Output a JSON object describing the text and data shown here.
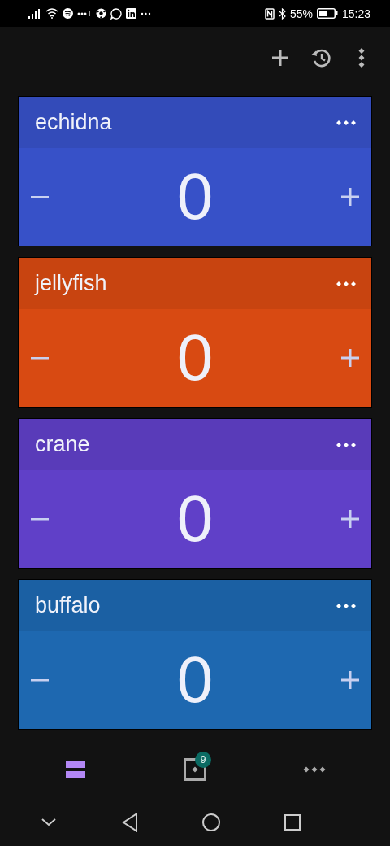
{
  "status_bar": {
    "battery": "55%",
    "time": "15:23"
  },
  "counters": [
    {
      "name": "echidna",
      "value": "0",
      "color": "#3751c8"
    },
    {
      "name": "jellyfish",
      "value": "0",
      "color": "#d84a12"
    },
    {
      "name": "crane",
      "value": "0",
      "color": "#6040c8"
    },
    {
      "name": "buffalo",
      "value": "0",
      "color": "#1e68b0"
    }
  ],
  "bottom_nav": [
    {
      "kind": "list",
      "selected": true
    },
    {
      "kind": "dice",
      "selected": false,
      "badge": "9"
    },
    {
      "kind": "more",
      "selected": false
    }
  ]
}
